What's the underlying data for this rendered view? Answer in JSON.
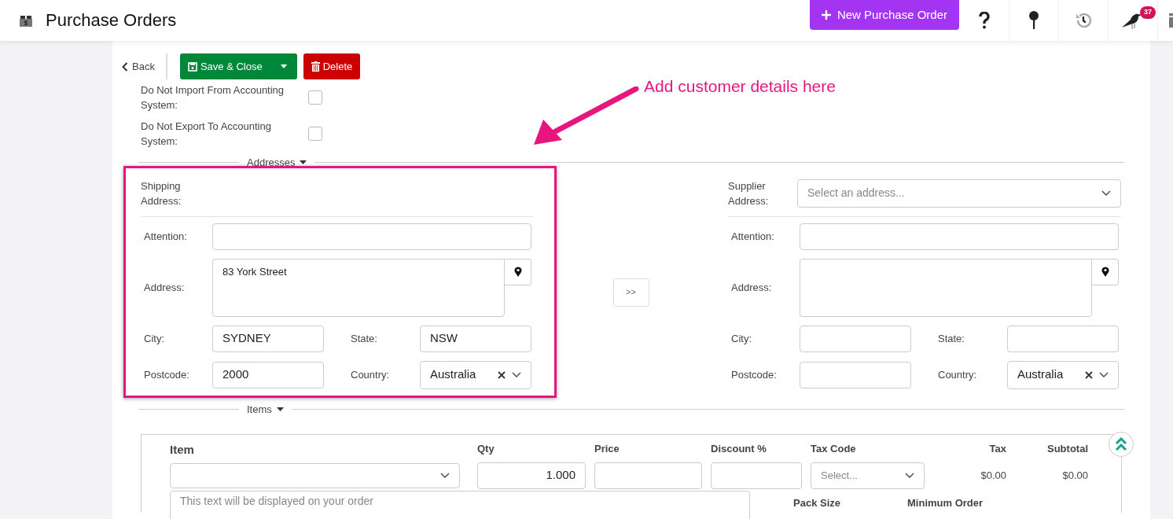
{
  "header": {
    "title": "Purchase Orders",
    "new_button": "New Purchase Order",
    "notification_count": "37"
  },
  "toolbar": {
    "back": "Back",
    "save": "Save & Close",
    "delete": "Delete"
  },
  "options": [
    {
      "label": "Do Not Import From Accounting System:",
      "checked": false
    },
    {
      "label": "Do Not Export To Accounting System:",
      "checked": false
    }
  ],
  "annotation": {
    "text": "Add customer details here"
  },
  "addresses": {
    "heading": "Addresses",
    "transfer_button": ">>",
    "blocks": [
      {
        "title": "Shipping Address:",
        "highlighted": true,
        "fields": [
          {
            "label": "Attention:"
          },
          {
            "label": "Address:",
            "value": "83 York Street"
          },
          {
            "label": "City:",
            "value": "SYDNEY"
          },
          {
            "label": "State:",
            "value": "NSW"
          },
          {
            "label": "Postcode:",
            "value": "2000"
          },
          {
            "label": "Country:",
            "value": "Australia"
          }
        ]
      },
      {
        "title": "Supplier Address:",
        "highlighted": false,
        "selector": {
          "placeholder": "Select an address..."
        },
        "fields": [
          {
            "label": "Attention:"
          },
          {
            "label": "Address:"
          },
          {
            "label": "City:"
          },
          {
            "label": "State:"
          },
          {
            "label": "Postcode:"
          },
          {
            "label": "Country:",
            "value": "Australia"
          }
        ]
      }
    ]
  },
  "items": {
    "heading": "Items",
    "columns": [
      "Item",
      "Qty",
      "Price",
      "Discount %",
      "Tax Code",
      "Tax",
      "Subtotal"
    ],
    "row": {
      "qty": "1.000",
      "tax_code_placeholder": "Select...",
      "tax": "$0.00",
      "subtotal": "$0.00",
      "description_placeholder": "This text will be displayed on your order"
    },
    "extra_labels": [
      "Pack Size",
      "Minimum Order"
    ]
  }
}
